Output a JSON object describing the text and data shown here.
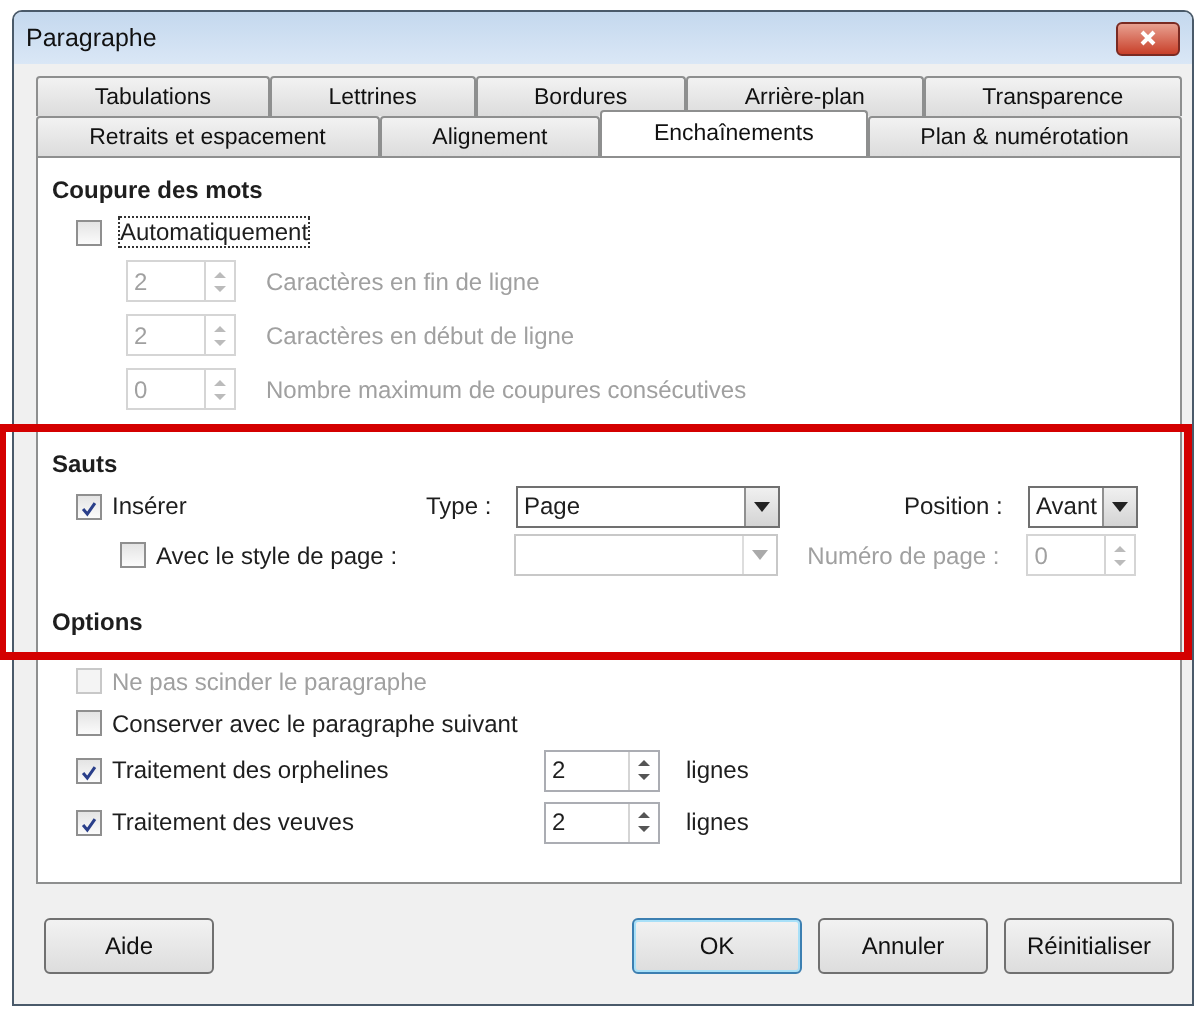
{
  "window": {
    "title": "Paragraphe"
  },
  "tab_rows": [
    {
      "tabs": [
        {
          "label": "Tabulations",
          "selected": false
        },
        {
          "label": "Lettrines",
          "selected": false
        },
        {
          "label": "Bordures",
          "selected": false
        },
        {
          "label": "Arrière-plan",
          "selected": false
        },
        {
          "label": "Transparence",
          "selected": false
        }
      ]
    },
    {
      "tabs": [
        {
          "label": "Retraits et espacement",
          "selected": false
        },
        {
          "label": "Alignement",
          "selected": false
        },
        {
          "label": "Enchaînements",
          "selected": true
        },
        {
          "label": "Plan & numérotation",
          "selected": false
        }
      ]
    }
  ],
  "hyphenation": {
    "heading": "Coupure des mots",
    "automatic": {
      "label": "Automatiquement",
      "checked": false
    },
    "spinners": [
      {
        "value": "2",
        "label": "Caractères en fin de ligne",
        "disabled": true
      },
      {
        "value": "2",
        "label": "Caractères en début de ligne",
        "disabled": true
      },
      {
        "value": "0",
        "label": "Nombre maximum de coupures consécutives",
        "disabled": true
      }
    ]
  },
  "breaks": {
    "heading": "Sauts",
    "highlighted": true,
    "insert": {
      "label": "Insérer",
      "checked": true
    },
    "type": {
      "label": "Type :",
      "value": "Page"
    },
    "position": {
      "label": "Position :",
      "value": "Avant"
    },
    "page_style": {
      "label": "Avec le style de page :",
      "checked": false
    },
    "page_style_select": {
      "disabled": true
    },
    "page_number": {
      "label": "Numéro de page :",
      "value": "0",
      "disabled": true
    }
  },
  "options": {
    "heading": "Options",
    "items": [
      {
        "kind": "plain",
        "label": "Ne pas scinder le paragraphe",
        "checked": false,
        "disabled": true
      },
      {
        "kind": "plain",
        "label": "Conserver avec le paragraphe suivant",
        "checked": false,
        "disabled": false
      },
      {
        "kind": "spin",
        "label": "Traitement des orphelines",
        "checked": true,
        "disabled": false,
        "value": "2",
        "unit": "lignes"
      },
      {
        "kind": "spin",
        "label": "Traitement des veuves",
        "checked": true,
        "disabled": false,
        "value": "2",
        "unit": "lignes"
      }
    ]
  },
  "buttons": [
    {
      "label": "Aide",
      "kind": "help"
    },
    {
      "label": "OK",
      "kind": "default"
    },
    {
      "label": "Annuler",
      "kind": "normal"
    },
    {
      "label": "Réinitialiser",
      "kind": "normal"
    }
  ]
}
